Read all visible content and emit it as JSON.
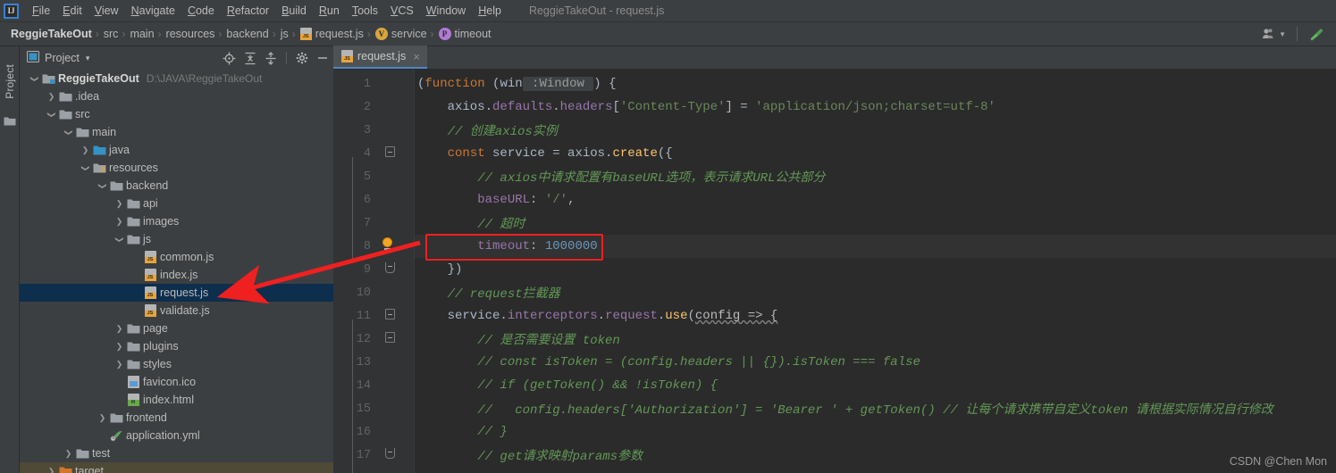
{
  "window": {
    "title": "ReggieTakeOut - request.js",
    "logo": "ij-logo",
    "logo_text": "IJ"
  },
  "menubar": {
    "items": [
      {
        "label": "File"
      },
      {
        "label": "Edit"
      },
      {
        "label": "View"
      },
      {
        "label": "Navigate"
      },
      {
        "label": "Code"
      },
      {
        "label": "Refactor"
      },
      {
        "label": "Build"
      },
      {
        "label": "Run"
      },
      {
        "label": "Tools"
      },
      {
        "label": "VCS"
      },
      {
        "label": "Window"
      },
      {
        "label": "Help"
      }
    ]
  },
  "breadcrumb": {
    "items": [
      {
        "label": "ReggieTakeOut",
        "icon": "none",
        "bold": true
      },
      {
        "label": "src",
        "icon": "none"
      },
      {
        "label": "main",
        "icon": "none"
      },
      {
        "label": "resources",
        "icon": "none"
      },
      {
        "label": "backend",
        "icon": "none"
      },
      {
        "label": "js",
        "icon": "none"
      },
      {
        "label": "request.js",
        "icon": "js-file-icon"
      },
      {
        "label": "service",
        "icon": "variable-badge-icon",
        "badge": "V",
        "badge_color": "#d9a441"
      },
      {
        "label": "timeout",
        "icon": "property-badge-icon",
        "badge": "P",
        "badge_color": "#b07bd4"
      }
    ],
    "separator": "›",
    "right_controls": [
      {
        "name": "account-icon",
        "label": ""
      },
      {
        "name": "build-hammer-icon",
        "label": ""
      }
    ]
  },
  "toolstrip": {
    "label": "Project",
    "icon": "folder-icon"
  },
  "project_panel": {
    "title": "Project",
    "title_icon": "project-view-icon",
    "caret": "▾",
    "tools": [
      {
        "name": "locate-target-icon"
      },
      {
        "name": "expand-all-icon"
      },
      {
        "name": "collapse-all-icon"
      },
      {
        "name": "settings-gear-icon"
      },
      {
        "name": "hide-panel-icon"
      }
    ],
    "tree": [
      {
        "label": "ReggieTakeOut",
        "path": "D:\\JAVA\\ReggieTakeOut",
        "depth": 0,
        "arrow": "open",
        "icon": "module-folder-icon",
        "bold": true,
        "selected": false
      },
      {
        "label": ".idea",
        "path": "",
        "depth": 1,
        "arrow": "closed",
        "icon": "folder-icon",
        "bold": false,
        "selected": false
      },
      {
        "label": "src",
        "path": "",
        "depth": 1,
        "arrow": "open",
        "icon": "folder-icon",
        "bold": false,
        "selected": false
      },
      {
        "label": "main",
        "path": "",
        "depth": 2,
        "arrow": "open",
        "icon": "folder-icon",
        "bold": false,
        "selected": false
      },
      {
        "label": "java",
        "path": "",
        "depth": 3,
        "arrow": "closed",
        "icon": "source-folder-icon",
        "bold": false,
        "selected": false
      },
      {
        "label": "resources",
        "path": "",
        "depth": 3,
        "arrow": "open",
        "icon": "resource-folder-icon",
        "bold": false,
        "selected": false
      },
      {
        "label": "backend",
        "path": "",
        "depth": 4,
        "arrow": "open",
        "icon": "folder-icon",
        "bold": false,
        "selected": false
      },
      {
        "label": "api",
        "path": "",
        "depth": 5,
        "arrow": "closed",
        "icon": "folder-icon",
        "bold": false,
        "selected": false
      },
      {
        "label": "images",
        "path": "",
        "depth": 5,
        "arrow": "closed",
        "icon": "folder-icon",
        "bold": false,
        "selected": false
      },
      {
        "label": "js",
        "path": "",
        "depth": 5,
        "arrow": "open",
        "icon": "folder-icon",
        "bold": false,
        "selected": false
      },
      {
        "label": "common.js",
        "path": "",
        "depth": 6,
        "arrow": "none",
        "icon": "js-file-icon",
        "bold": false,
        "selected": false
      },
      {
        "label": "index.js",
        "path": "",
        "depth": 6,
        "arrow": "none",
        "icon": "js-file-icon",
        "bold": false,
        "selected": false
      },
      {
        "label": "request.js",
        "path": "",
        "depth": 6,
        "arrow": "none",
        "icon": "js-file-icon",
        "bold": false,
        "selected": true
      },
      {
        "label": "validate.js",
        "path": "",
        "depth": 6,
        "arrow": "none",
        "icon": "js-file-icon",
        "bold": false,
        "selected": false
      },
      {
        "label": "page",
        "path": "",
        "depth": 5,
        "arrow": "closed",
        "icon": "folder-icon",
        "bold": false,
        "selected": false
      },
      {
        "label": "plugins",
        "path": "",
        "depth": 5,
        "arrow": "closed",
        "icon": "folder-icon",
        "bold": false,
        "selected": false
      },
      {
        "label": "styles",
        "path": "",
        "depth": 5,
        "arrow": "closed",
        "icon": "folder-icon",
        "bold": false,
        "selected": false
      },
      {
        "label": "favicon.ico",
        "path": "",
        "depth": 5,
        "arrow": "none",
        "icon": "ico-file-icon",
        "bold": false,
        "selected": false
      },
      {
        "label": "index.html",
        "path": "",
        "depth": 5,
        "arrow": "none",
        "icon": "html-file-icon",
        "bold": false,
        "selected": false
      },
      {
        "label": "frontend",
        "path": "",
        "depth": 4,
        "arrow": "closed",
        "icon": "folder-icon",
        "bold": false,
        "selected": false
      },
      {
        "label": "application.yml",
        "path": "",
        "depth": 4,
        "arrow": "none",
        "icon": "yml-file-icon",
        "bold": false,
        "selected": false
      },
      {
        "label": "test",
        "path": "",
        "depth": 2,
        "arrow": "closed",
        "icon": "folder-icon",
        "bold": false,
        "selected": false
      },
      {
        "label": "target",
        "path": "",
        "depth": 1,
        "arrow": "closed",
        "icon": "excluded-folder-icon",
        "bold": false,
        "selected": false,
        "bottom_highlight": true
      }
    ]
  },
  "editor": {
    "tabs": [
      {
        "label": "request.js",
        "icon": "js-file-icon",
        "active": true,
        "close": "×"
      }
    ],
    "highlighted_line": 8,
    "annotation_box_line": 8,
    "lines": [
      {
        "no": 1,
        "tokens": [
          {
            "t": "(",
            "c": "pln"
          },
          {
            "t": "function",
            "c": "kw"
          },
          {
            "t": " (",
            "c": "pln"
          },
          {
            "t": "win",
            "c": "pln"
          },
          {
            "t": " :Window ",
            "c": "hint"
          },
          {
            "t": ") {",
            "c": "pln"
          }
        ],
        "fold": "none"
      },
      {
        "no": 2,
        "tokens": [
          {
            "t": "    axios",
            "c": "pln"
          },
          {
            "t": ".",
            "c": "pln"
          },
          {
            "t": "defaults",
            "c": "prop"
          },
          {
            "t": ".",
            "c": "pln"
          },
          {
            "t": "headers",
            "c": "prop"
          },
          {
            "t": "[",
            "c": "pln"
          },
          {
            "t": "'Content-Type'",
            "c": "str"
          },
          {
            "t": "] = ",
            "c": "pln"
          },
          {
            "t": "'application/json;charset=utf-8'",
            "c": "str"
          }
        ],
        "fold": "none"
      },
      {
        "no": 3,
        "tokens": [
          {
            "t": "    // 创建axios实例",
            "c": "cmt"
          }
        ],
        "fold": "none"
      },
      {
        "no": 4,
        "tokens": [
          {
            "t": "    ",
            "c": "pln"
          },
          {
            "t": "const",
            "c": "kw"
          },
          {
            "t": " service = axios.",
            "c": "pln"
          },
          {
            "t": "create",
            "c": "fn"
          },
          {
            "t": "({",
            "c": "pln"
          }
        ],
        "fold": "start"
      },
      {
        "no": 5,
        "tokens": [
          {
            "t": "        // axios中请求配置有baseURL选项，表示请求URL公共部分",
            "c": "cmt"
          }
        ],
        "fold": "none"
      },
      {
        "no": 6,
        "tokens": [
          {
            "t": "        ",
            "c": "pln"
          },
          {
            "t": "baseURL",
            "c": "prop"
          },
          {
            "t": ": ",
            "c": "pln"
          },
          {
            "t": "'/'",
            "c": "str"
          },
          {
            "t": ",",
            "c": "pln"
          }
        ],
        "fold": "none"
      },
      {
        "no": 7,
        "tokens": [
          {
            "t": "        // 超时",
            "c": "cmt"
          }
        ],
        "fold": "none"
      },
      {
        "no": 8,
        "tokens": [
          {
            "t": "        ",
            "c": "pln"
          },
          {
            "t": "timeout",
            "c": "prop"
          },
          {
            "t": ": ",
            "c": "pln"
          },
          {
            "t": "1000000",
            "c": "num"
          }
        ],
        "fold": "bulb"
      },
      {
        "no": 9,
        "tokens": [
          {
            "t": "    })",
            "c": "pln"
          }
        ],
        "fold": "end"
      },
      {
        "no": 10,
        "tokens": [
          {
            "t": "    // request拦截器",
            "c": "cmt"
          }
        ],
        "fold": "none"
      },
      {
        "no": 11,
        "tokens": [
          {
            "t": "    service",
            "c": "pln"
          },
          {
            "t": ".",
            "c": "pln"
          },
          {
            "t": "interceptors",
            "c": "prop"
          },
          {
            "t": ".",
            "c": "pln"
          },
          {
            "t": "request",
            "c": "prop"
          },
          {
            "t": ".",
            "c": "pln"
          },
          {
            "t": "use",
            "c": "fn"
          },
          {
            "t": "(",
            "c": "pln"
          },
          {
            "t": "config => {",
            "c": "squig"
          }
        ],
        "fold": "start"
      },
      {
        "no": 12,
        "tokens": [
          {
            "t": "        // 是否需要设置 token",
            "c": "cmt"
          }
        ],
        "fold": "start"
      },
      {
        "no": 13,
        "tokens": [
          {
            "t": "        // const isToken = (config.headers || {}).isToken === false",
            "c": "cmt"
          }
        ],
        "fold": "none"
      },
      {
        "no": 14,
        "tokens": [
          {
            "t": "        // if (getToken() && !isToken) {",
            "c": "cmt"
          }
        ],
        "fold": "none"
      },
      {
        "no": 15,
        "tokens": [
          {
            "t": "        //   config.headers['Authorization'] = 'Bearer ' + getToken() // 让每个请求携带自定义token 请根据实际情况自行修改",
            "c": "cmt"
          }
        ],
        "fold": "none"
      },
      {
        "no": 16,
        "tokens": [
          {
            "t": "        // }",
            "c": "cmt"
          }
        ],
        "fold": "none"
      },
      {
        "no": 17,
        "tokens": [
          {
            "t": "        // get请求映射params参数",
            "c": "cmt"
          }
        ],
        "fold": "end"
      }
    ]
  },
  "annotations": {
    "arrow_color": "#f02020",
    "box_color": "#f02020"
  },
  "watermark": "CSDN @Chen Mon",
  "colors": {
    "chrome_bg": "#3c3f41",
    "editor_bg": "#2b2b2b",
    "gutter_bg": "#313335",
    "selection_bg": "#0d2e4d",
    "accent": "#4a88c7"
  }
}
